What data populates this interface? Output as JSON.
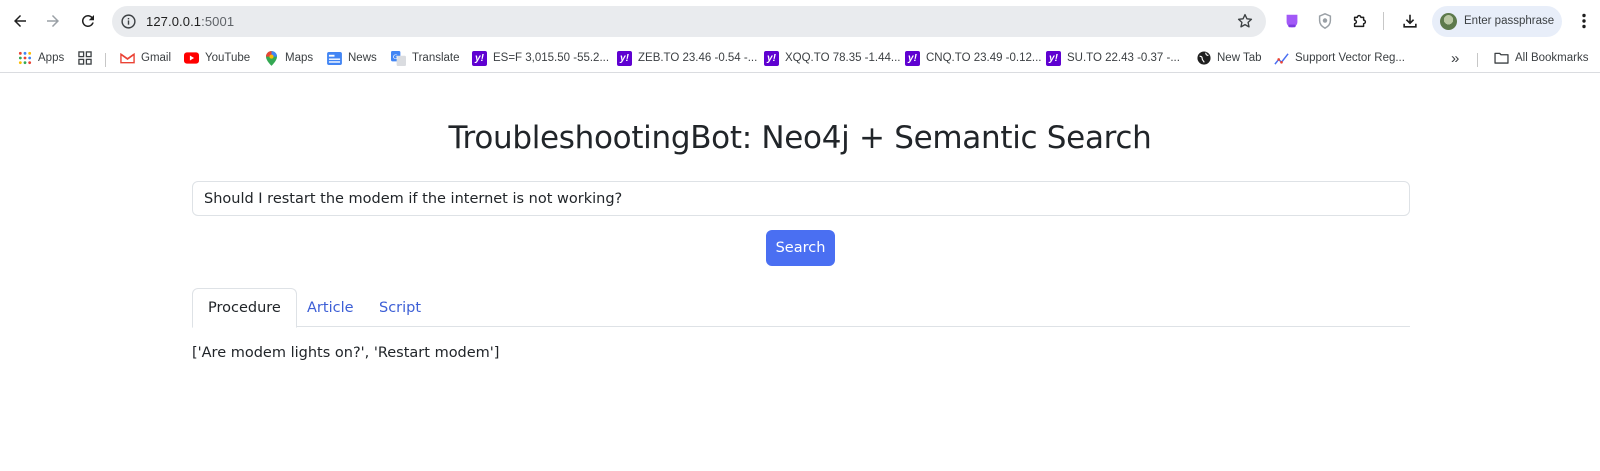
{
  "browser": {
    "url_host": "127.0.0.1",
    "url_port": ":5001",
    "profile_label": "Enter passphrase",
    "bookmarks": [
      {
        "label": "Apps"
      },
      {
        "label": "Gmail"
      },
      {
        "label": "YouTube"
      },
      {
        "label": "Maps"
      },
      {
        "label": "News"
      },
      {
        "label": "Translate"
      },
      {
        "label": "ES=F 3,015.50 -55.2..."
      },
      {
        "label": "ZEB.TO 23.46 -0.54 -..."
      },
      {
        "label": "XQQ.TO 78.35 -1.44..."
      },
      {
        "label": "CNQ.TO 23.49 -0.12..."
      },
      {
        "label": "SU.TO 22.43 -0.37 -..."
      },
      {
        "label": "New Tab"
      },
      {
        "label": "Support Vector Reg..."
      }
    ],
    "all_bookmarks_label": "All Bookmarks",
    "more_label": "»"
  },
  "page": {
    "title": "TroubleshootingBot: Neo4j + Semantic Search",
    "query_value": "Should I restart the modem if the internet is not working?",
    "search_label": "Search",
    "tabs": [
      {
        "label": "Procedure",
        "active": true
      },
      {
        "label": "Article",
        "active": false
      },
      {
        "label": "Script",
        "active": false
      }
    ],
    "result_text": "['Are modem lights on?', 'Restart modem']"
  },
  "colors": {
    "accent": "#4a6ff2",
    "tab_link": "#3d5fd6",
    "yahoo": "#5f01d1"
  }
}
